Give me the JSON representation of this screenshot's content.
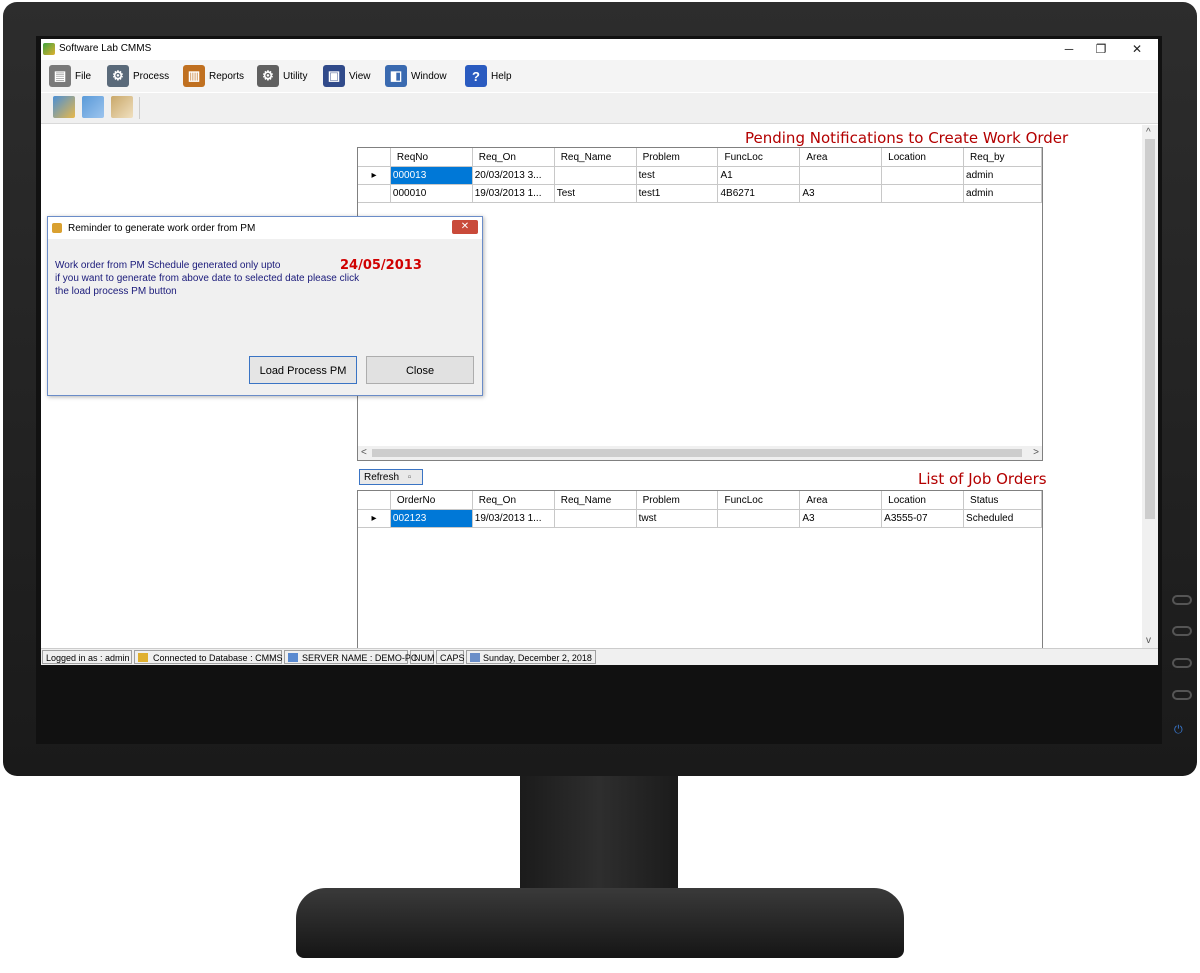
{
  "window": {
    "title": "Software Lab CMMS",
    "minimize": "─",
    "restore": "❐",
    "close": "✕"
  },
  "menu": [
    {
      "label": "File",
      "icon": "file-cabinet-icon",
      "color": "#7a7a7a",
      "glyph": "▤"
    },
    {
      "label": "Process",
      "icon": "process-gears-icon",
      "color": "#5a6a7a",
      "glyph": "⚙"
    },
    {
      "label": "Reports",
      "icon": "reports-chart-icon",
      "color": "#c07020",
      "glyph": "▥"
    },
    {
      "label": "Utility",
      "icon": "utility-gear-icon",
      "color": "#606060",
      "glyph": "⚙"
    },
    {
      "label": "View",
      "icon": "view-monitor-icon",
      "color": "#304a8a",
      "glyph": "▣"
    },
    {
      "label": "Window",
      "icon": "window-icon",
      "color": "#3a6ab0",
      "glyph": "◧"
    },
    {
      "label": "Help",
      "icon": "help-question-icon",
      "color": "#2a5bc0",
      "glyph": "?"
    }
  ],
  "toolbar": [
    {
      "icon": "cut-icon",
      "color": "#4a8fd6"
    },
    {
      "icon": "copy-icon",
      "color": "#5a9ad8"
    },
    {
      "icon": "paste-icon",
      "color": "#c9a86a"
    }
  ],
  "pending": {
    "title": "Pending Notifications to Create Work Order",
    "columns": [
      "ReqNo",
      "Req_On",
      "Req_Name",
      "Problem",
      "FuncLoc",
      "Area",
      "Location",
      "Req_by"
    ],
    "rows": [
      [
        "000013",
        "20/03/2013 3...",
        "",
        "test",
        "A1",
        "",
        "",
        "admin"
      ],
      [
        "000010",
        "19/03/2013 1...",
        "Test",
        "test1",
        "4B6271",
        "A3",
        "",
        "admin"
      ]
    ],
    "scroll_left": "<",
    "scroll_right": ">"
  },
  "refresh_label": "Refresh",
  "jobs": {
    "title": "List of Job Orders",
    "columns": [
      "OrderNo",
      "Req_On",
      "Req_Name",
      "Problem",
      "FuncLoc",
      "Area",
      "Location",
      "Status"
    ],
    "rows": [
      [
        "002123",
        "19/03/2013 1...",
        "",
        "twst",
        "",
        "A3",
        "A3555-07",
        "Scheduled"
      ]
    ]
  },
  "dialog": {
    "title": "Reminder to generate work order from  PM",
    "close_glyph": "✕",
    "line1": "Work order from PM Schedule generated only upto",
    "line2": "if you want to generate from above date to selected date please click",
    "line3": "the load process PM button",
    "date": "24/05/2013",
    "load_button": "Load Process PM",
    "close_button": "Close"
  },
  "status": {
    "user": "Logged in as : admin",
    "database": "Connected to Database : CMMS",
    "server": "SERVER NAME : DEMO-PC",
    "num": "NUM",
    "caps": "CAPS",
    "date": "Sunday, December 2, 2018"
  },
  "row_marker": "▸",
  "vscroll_up": "^",
  "vscroll_down": "v"
}
